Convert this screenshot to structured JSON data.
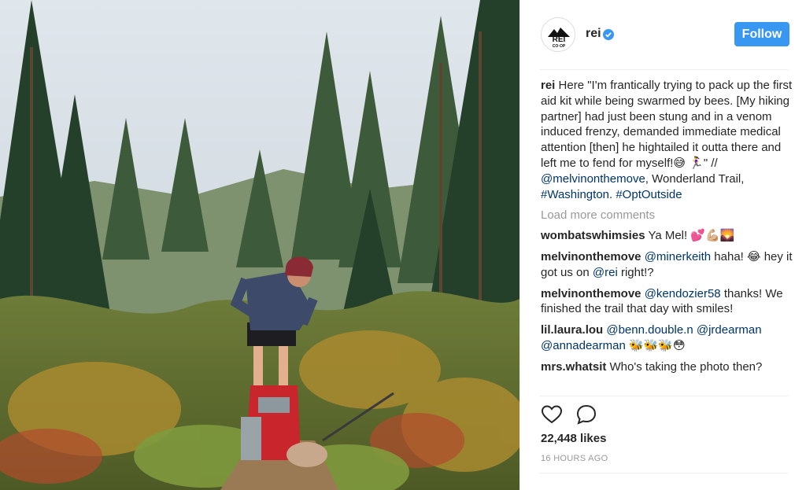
{
  "header": {
    "username": "rei",
    "avatar_text": "REI",
    "avatar_subtext": "CO·OP",
    "follow_label": "Follow",
    "verified": true
  },
  "caption": {
    "user": "rei",
    "text1": " Here \"I'm frantically trying to pack up the first aid kit while being swarmed by bees. [My hiking partner] had just been stung and in a venom induced frenzy, demanded immediate medical attention [then] he hightailed it outta there and left me to fend for myself!😅 🏃‍♀️\" // ",
    "mention": "@melvinonthemove",
    "text2": ", Wonderland Trail, ",
    "tag1": "#Washington",
    "text3": ". ",
    "tag2": "#OptOutside"
  },
  "load_more": "Load more comments",
  "comments": [
    {
      "user": "wombatswhimsies",
      "pre": " Ya Mel! 💕💪🏼🌄",
      "mention": "",
      "post": ""
    },
    {
      "user": "melvinonthemove",
      "pre": " ",
      "mention": "@minerkeith",
      "post": " haha! 😂 hey it got us on ",
      "mention2": "@rei",
      "post2": " right!?"
    },
    {
      "user": "melvinonthemove",
      "pre": " ",
      "mention": "@kendozier58",
      "post": " thanks! We finished the trail that day with smiles!"
    },
    {
      "user": "lil.laura.lou",
      "pre": " ",
      "mention": "@benn.double.n",
      "post": " ",
      "mention2": "@jrdearman",
      "post2": " ",
      "mention3": "@annadearman",
      "post3": " 🐝🐝🐝😳"
    },
    {
      "user": "mrs.whatsit",
      "pre": " Who's taking the photo then?",
      "mention": "",
      "post": ""
    }
  ],
  "actions": {
    "like_icon": "heart-icon",
    "comment_icon": "comment-icon"
  },
  "likes": "22,448 likes",
  "timestamp": "16 HOURS AGO",
  "colors": {
    "accent": "#3897f0",
    "link": "#003569",
    "muted": "#999999"
  }
}
